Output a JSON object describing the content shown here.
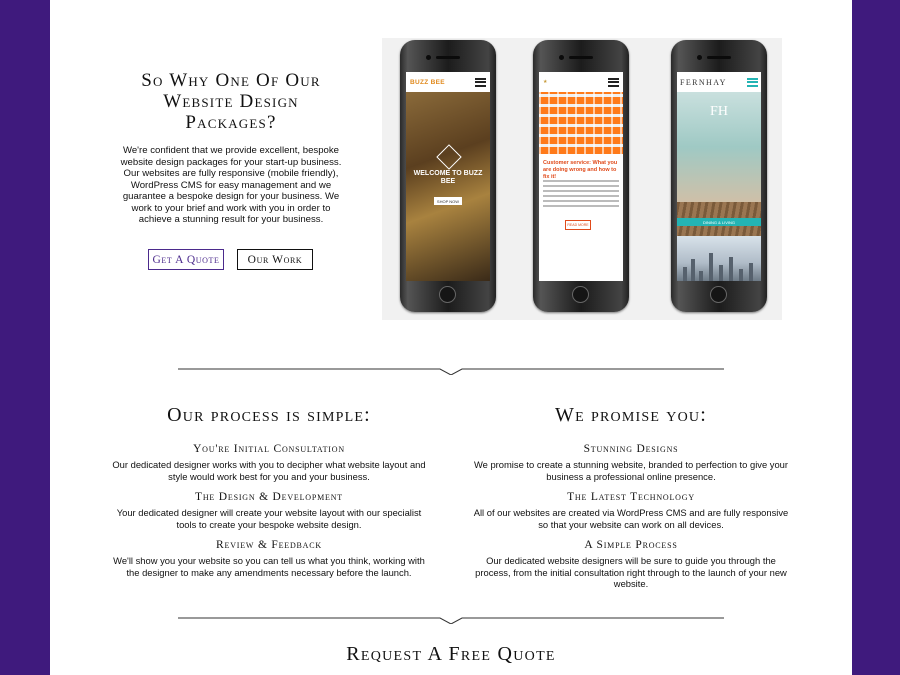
{
  "hero": {
    "title": "So Why One Of Our Website Design Packages?",
    "body": "We're confident that we provide excellent, bespoke website design packages for your start-up business. Our websites are fully responsive (mobile friendly), WordPress CMS for easy management and we guarantee a bespoke design for your business. We work to your brief and work with you in order to achieve a stunning result for your business.",
    "quote_button": "Get A Quote",
    "work_button": "Our Work"
  },
  "phones": {
    "p1": {
      "logo": "BUZZ BEE",
      "welcome": "WELCOME TO BUZZ BEE",
      "button": "SHOP NOW"
    },
    "p2": {
      "heading": "Customer service: What you are doing wrong and how to fix it!",
      "button": "READ MORE"
    },
    "p3": {
      "logo": "FERNHAY",
      "monogram": "FH",
      "bar": "DINING & LIVING"
    }
  },
  "process": {
    "title": "Our process is simple:",
    "steps": [
      {
        "heading": "You're Initial Consultation",
        "text": "Our dedicated designer works with you to decipher what website layout and style would work best for you and your business."
      },
      {
        "heading": "The Design & Development",
        "text": "Your dedicated designer will create your website layout with our specialist tools to create your bespoke website design."
      },
      {
        "heading": "Review & Feedback",
        "text": "We'll show you your website so you can tell us what you think, working with the designer to make any amendments necessary before the launch."
      }
    ]
  },
  "promise": {
    "title": "We promise you:",
    "items": [
      {
        "heading": "Stunning Designs",
        "text": "We promise to create a stunning website, branded to perfection to give your business a professional online presence."
      },
      {
        "heading": "The Latest Technology",
        "text": "All of our websites are created via WordPress CMS and are fully responsive so that your website can work on all devices."
      },
      {
        "heading": "A Simple Process",
        "text": "Our dedicated website designers will be sure to guide you through the process, from the initial consultation right through to the launch of your new website."
      }
    ]
  },
  "footer": {
    "title": "Request A Free Quote"
  },
  "colors": {
    "frame": "#3f1a7d",
    "accent": "#4b2a8c",
    "text": "#111111"
  }
}
